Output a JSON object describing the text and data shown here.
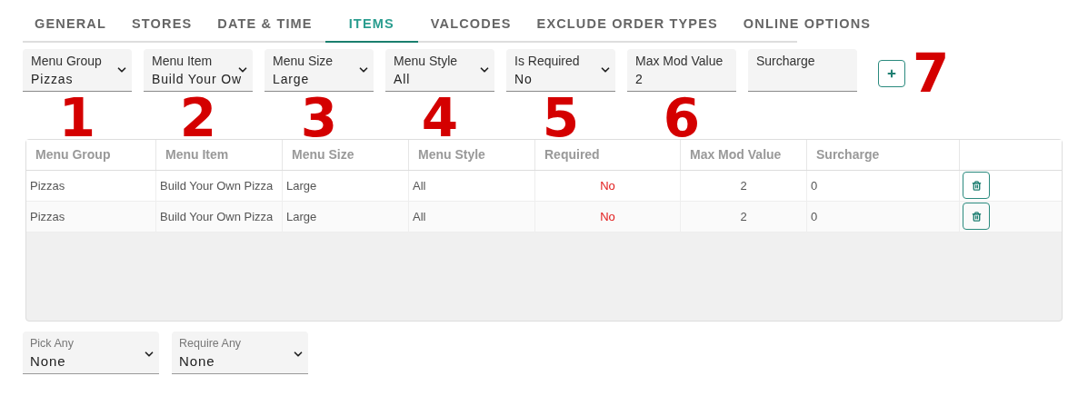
{
  "tabs": [
    {
      "label": "GENERAL",
      "selected": false
    },
    {
      "label": "STORES",
      "selected": false
    },
    {
      "label": "DATE & TIME",
      "selected": false
    },
    {
      "label": "ITEMS",
      "selected": true
    },
    {
      "label": "VALCODES",
      "selected": false
    },
    {
      "label": "EXCLUDE ORDER TYPES",
      "selected": false
    },
    {
      "label": "ONLINE OPTIONS",
      "selected": false
    }
  ],
  "filters": [
    {
      "kind": "select",
      "label": "Menu Group",
      "value": "Pizzas",
      "annotation": "1"
    },
    {
      "kind": "select",
      "label": "Menu Item",
      "value": "Build Your Ow",
      "annotation": "2"
    },
    {
      "kind": "select",
      "label": "Menu Size",
      "value": "Large",
      "annotation": "3"
    },
    {
      "kind": "select",
      "label": "Menu Style",
      "value": "All",
      "annotation": "4"
    },
    {
      "kind": "select",
      "label": "Is Required",
      "value": "No",
      "annotation": "5"
    },
    {
      "kind": "text",
      "label": "Max Mod Value",
      "value": "2",
      "annotation": "6"
    },
    {
      "kind": "text",
      "label": "Surcharge"
    }
  ],
  "add_button": {
    "annotation": "7"
  },
  "table": {
    "columns": [
      {
        "label": "Menu Group",
        "kind": "text"
      },
      {
        "label": "Menu Item",
        "kind": "text"
      },
      {
        "label": "Menu Size",
        "kind": "text"
      },
      {
        "label": "Menu Style",
        "kind": "text"
      },
      {
        "label": "Required",
        "kind": "flag"
      },
      {
        "label": "Max Mod Value",
        "kind": "number"
      },
      {
        "label": "Surcharge",
        "kind": "text"
      }
    ],
    "rows": [
      {
        "cells": [
          "Pizzas",
          "Build Your Own Pizza",
          "Large",
          "All",
          "No",
          "2",
          "0"
        ]
      },
      {
        "cells": [
          "Pizzas",
          "Build Your Own Pizza",
          "Large",
          "All",
          "No",
          "2",
          "0"
        ]
      }
    ]
  },
  "bottom_selects": [
    {
      "label": "Pick Any",
      "value": "None"
    },
    {
      "label": "Require Any",
      "value": "None"
    }
  ]
}
